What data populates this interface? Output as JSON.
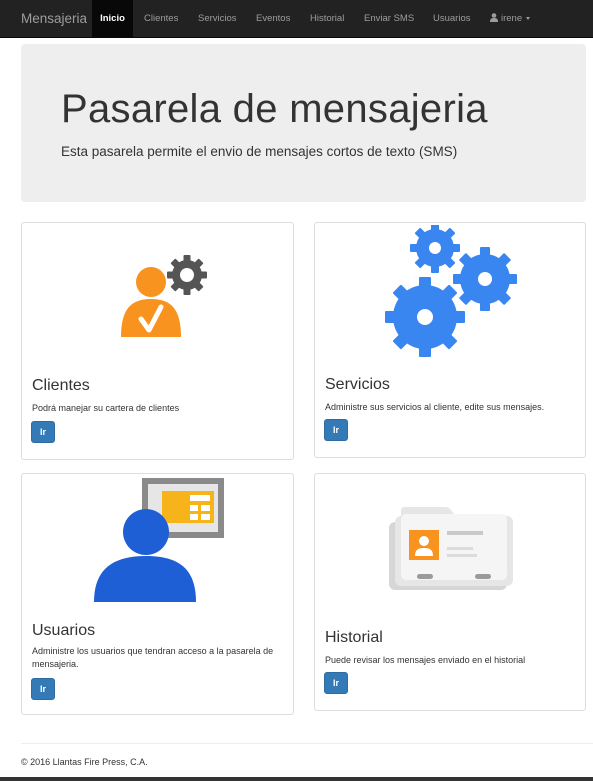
{
  "navbar": {
    "brand": "Mensajeria",
    "items": [
      {
        "label": "Inicio",
        "active": true
      },
      {
        "label": "Clientes"
      },
      {
        "label": "Servicios"
      },
      {
        "label": "Eventos"
      },
      {
        "label": "Historial"
      },
      {
        "label": "Enviar SMS"
      },
      {
        "label": "Usuarios"
      }
    ],
    "user": {
      "label": "irene",
      "icon": "user-icon"
    }
  },
  "jumbotron": {
    "title": "Pasarela de mensajeria",
    "subtitle": "Esta pasarela permite el envio de mensajes cortos de texto (SMS)"
  },
  "cards": [
    {
      "title": "Clientes",
      "text": "Podrá manejar su cartera de clientes",
      "button": "Ir",
      "icon": "client-user-gear-icon"
    },
    {
      "title": "Servicios",
      "text": "Administre sus servicios al cliente, edite sus mensajes.",
      "button": "Ir",
      "icon": "gears-icon"
    },
    {
      "title": "Usuarios",
      "text": "Administre los usuarios que tendran acceso a la pasarela de mensajeria.",
      "button": "Ir",
      "icon": "user-presentation-icon"
    },
    {
      "title": "Historial",
      "text": "Puede revisar los mensajes enviado en el historial",
      "button": "Ir",
      "icon": "contact-folder-icon"
    }
  ],
  "footer": {
    "text": "© 2016 Llantas Fire Press, C.A."
  },
  "colors": {
    "navbar": "#222222",
    "primary": "#337ab7",
    "jumbotron": "#eeeeee",
    "orange": "#f7931e",
    "blue": "#3a86f0"
  }
}
